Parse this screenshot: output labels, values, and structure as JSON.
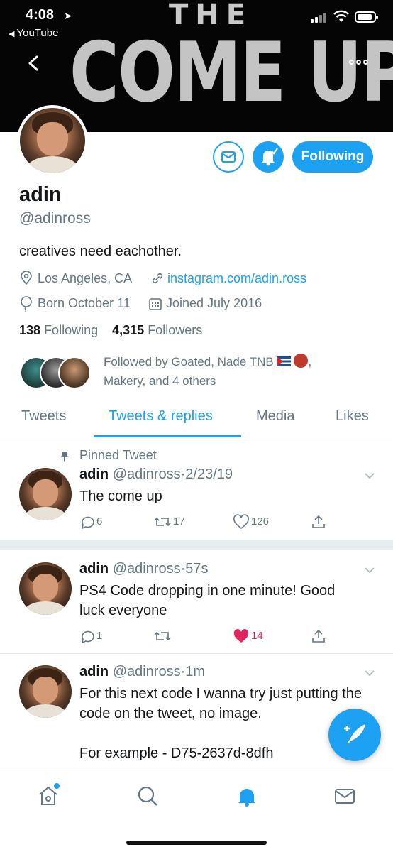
{
  "status_bar": {
    "time": "4:08",
    "back_app": "YouTube"
  },
  "banner": {
    "line1": "THE",
    "line2": "COME UP"
  },
  "profile": {
    "display_name": "adin",
    "handle": "@adinross",
    "bio": "creatives need eachother.",
    "location": "Los Angeles, CA",
    "website": "instagram.com/adin.ross",
    "birthday": "Born October 11",
    "joined": "Joined July 2016",
    "following_count": "138",
    "following_label": "Following",
    "followers_count": "4,315",
    "followers_label": "Followers",
    "followed_by_line1": "Followed by Goated, Nade TNB",
    "followed_by_line1_end": ",",
    "followed_by_line2": "Makery, and 4 others",
    "follow_button": "Following"
  },
  "tabs": [
    {
      "label": "Tweets",
      "active": false
    },
    {
      "label": "Tweets & replies",
      "active": true
    },
    {
      "label": "Media",
      "active": false
    },
    {
      "label": "Likes",
      "active": false
    }
  ],
  "tweets": [
    {
      "pinned_label": "Pinned Tweet",
      "name": "adin",
      "handle": "@adinross",
      "separator": "·",
      "time": "2/23/19",
      "text": "The come up",
      "replies": "6",
      "retweets": "17",
      "likes": "126",
      "liked": false
    },
    {
      "name": "adin",
      "handle": "@adinross",
      "separator": "·",
      "time": "57s",
      "text": "PS4 Code dropping in one minute! Good luck everyone",
      "replies": "1",
      "retweets": "",
      "likes": "14",
      "liked": true
    },
    {
      "name": "adin",
      "handle": "@adinross",
      "separator": "·",
      "time": "1m",
      "text": "For this next code I wanna try just putting the code on the tweet, no image.\n\nFor example - D75-2637d-8dfh"
    }
  ],
  "colors": {
    "accent": "#1da1f2",
    "like": "#e0245e",
    "muted": "#657786"
  },
  "icons": [
    "back-chevron-icon",
    "more-icon",
    "mail-icon",
    "bell-check-icon",
    "location-pin-icon",
    "link-icon",
    "birthday-balloon-icon",
    "calendar-icon",
    "pin-icon",
    "chevron-down-icon",
    "reply-icon",
    "retweet-icon",
    "heart-icon",
    "share-icon",
    "compose-icon",
    "home-icon",
    "search-icon",
    "notifications-icon",
    "messages-icon"
  ]
}
